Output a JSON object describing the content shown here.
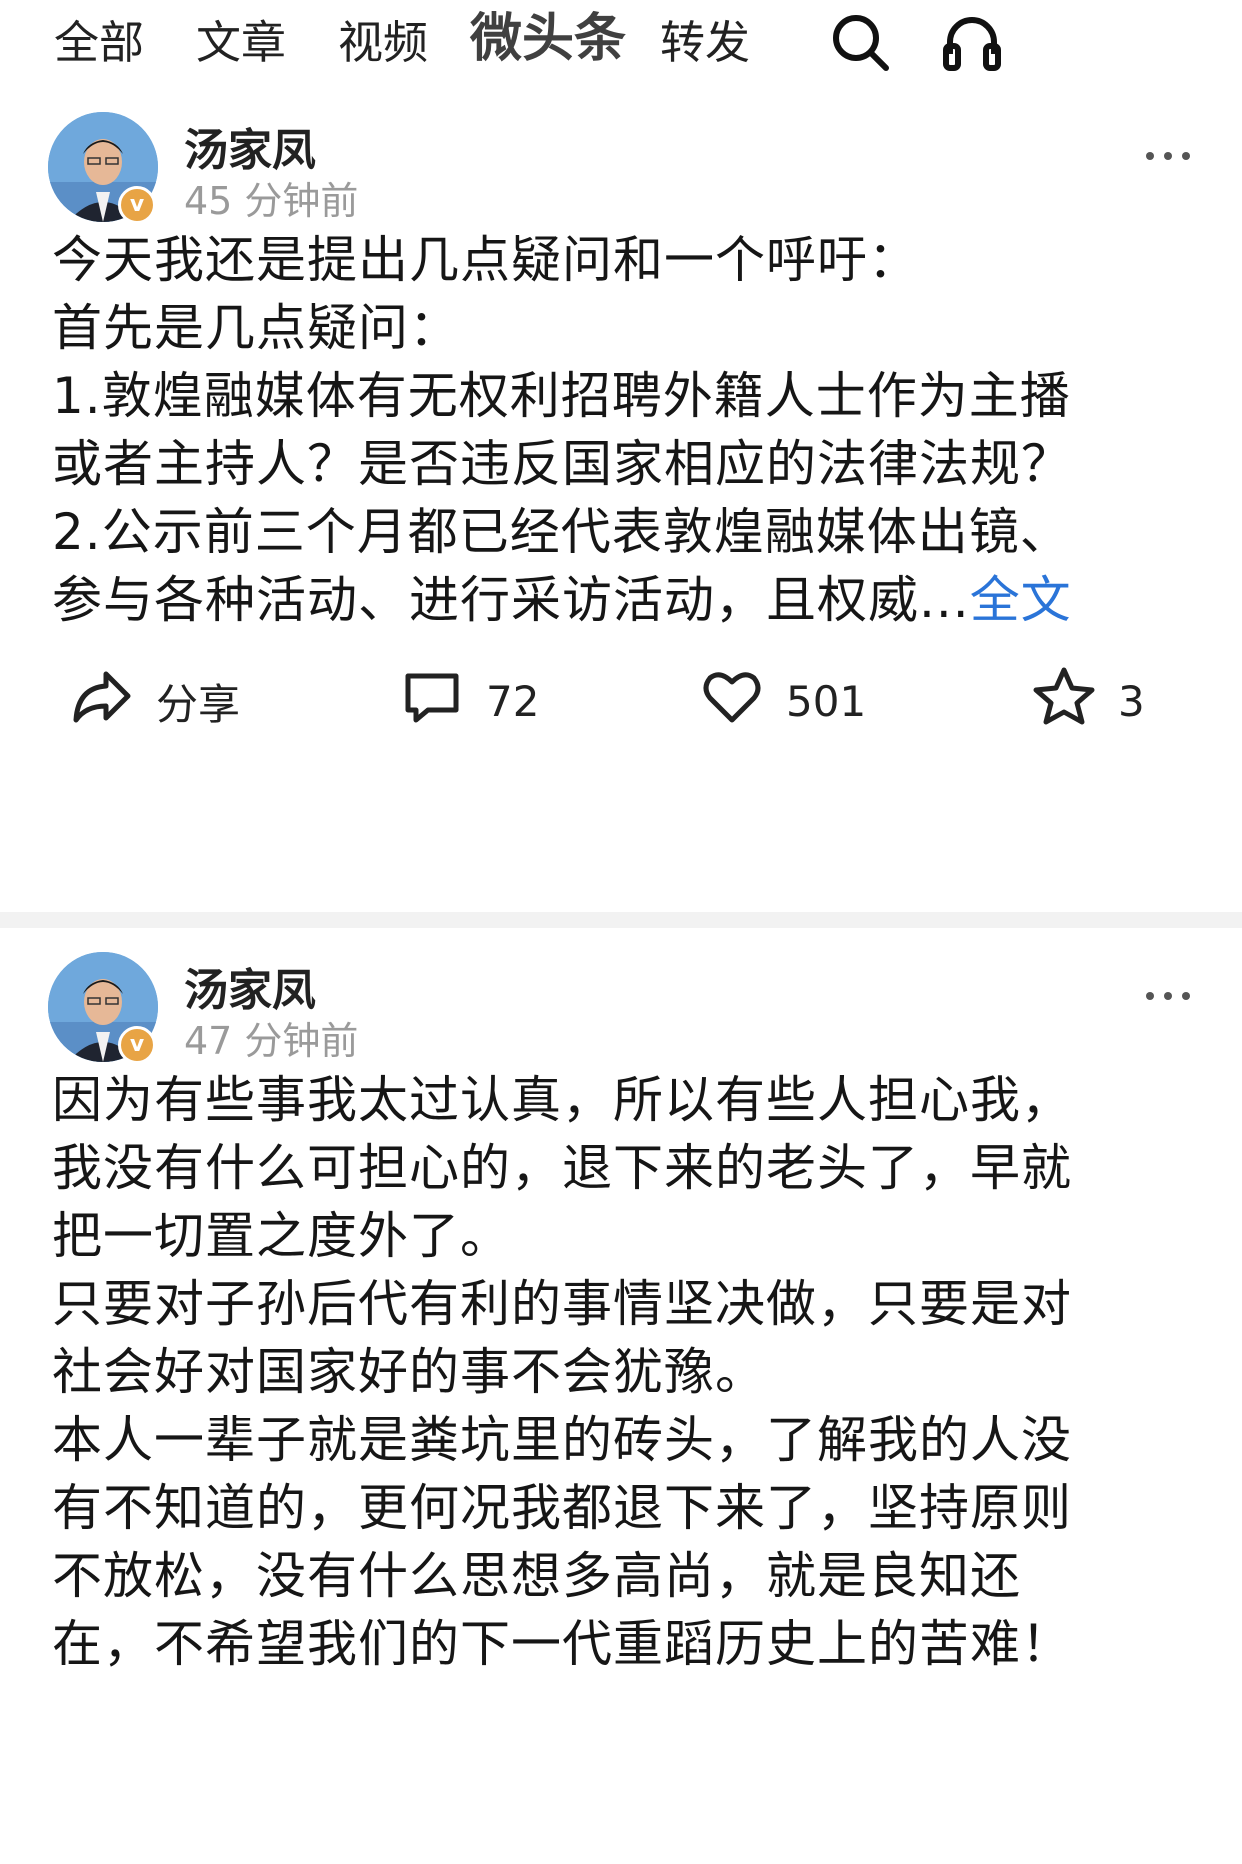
{
  "tabs": [
    {
      "label": "全部"
    },
    {
      "label": "文章"
    },
    {
      "label": "视频"
    },
    {
      "label": "微头条",
      "active": true
    },
    {
      "label": "转发"
    }
  ],
  "icons": {
    "search": "search-icon",
    "headphones": "headphones-icon"
  },
  "colors": {
    "link": "#2a74d8",
    "muted": "#9a9a9a",
    "verified": "#e8a445",
    "divider": "#f2f2f2"
  },
  "posts": [
    {
      "author": "汤家凤",
      "time": "45 分钟前",
      "lines": [
        "今天我还是提出几点疑问和一个呼吁：",
        "首先是几点疑问：",
        "1.敦煌融媒体有无权利招聘外籍人士作为主播",
        "或者主持人？是否违反国家相应的法律法规？",
        "2.公示前三个月都已经代表敦煌融媒体出镜、",
        "参与各种活动、进行采访活动，且权威..."
      ],
      "full_text_label": "全文",
      "share_label": "分享",
      "comments": "72",
      "likes": "501",
      "favorites": "3"
    },
    {
      "author": "汤家凤",
      "time": "47 分钟前",
      "lines": [
        "因为有些事我太过认真，所以有些人担心我，",
        "我没有什么可担心的，退下来的老头了，早就",
        "把一切置之度外了。",
        "只要对子孙后代有利的事情坚决做，只要是对",
        "社会好对国家好的事不会犹豫。",
        "本人一辈子就是粪坑里的砖头，了解我的人没",
        "有不知道的，更何况我都退下来了，坚持原则",
        "不放松，没有什么思想多高尚，就是良知还",
        "在，不希望我们的下一代重蹈历史上的苦难！"
      ]
    }
  ]
}
